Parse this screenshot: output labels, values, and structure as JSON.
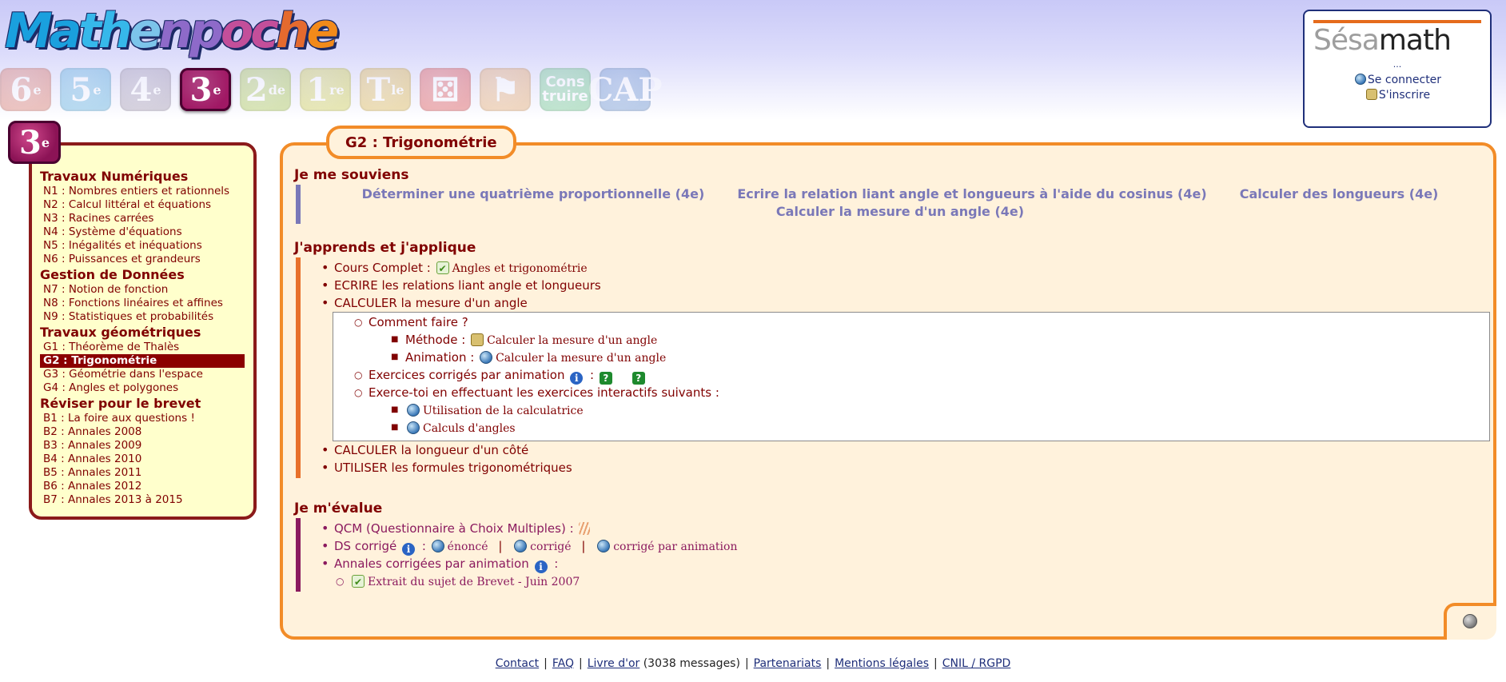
{
  "logo": {
    "text": "Mathenpoche"
  },
  "levels": [
    {
      "label": "6",
      "sup": "e",
      "color": "#d46a5a",
      "active": false
    },
    {
      "label": "5",
      "sup": "e",
      "color": "#4aa6d8",
      "active": false
    },
    {
      "label": "4",
      "sup": "e",
      "color": "#9a8fa8",
      "active": false
    },
    {
      "label": "3",
      "sup": "e",
      "color": "#a01864",
      "active": true
    },
    {
      "label": "2",
      "sup": "de",
      "color": "#a0c040",
      "active": false
    },
    {
      "label": "1",
      "sup": "re",
      "color": "#c8c840",
      "active": false
    },
    {
      "label": "T",
      "sup": "le",
      "color": "#d8b040",
      "active": false
    },
    {
      "label": "⚄",
      "sup": "",
      "color": "#d84040",
      "active": false
    },
    {
      "label": "⚑",
      "sup": "",
      "color": "#e0a060",
      "active": false
    },
    {
      "label": "Cons truire",
      "sup": "",
      "color": "#60c080",
      "active": false
    },
    {
      "label": "CAP",
      "sup": "",
      "color": "#5a88c8",
      "active": false
    }
  ],
  "sesamath": {
    "logo_parts": [
      "Sésa",
      "math"
    ],
    "dots": "...",
    "login": "Se connecter",
    "signup": "S'inscrire"
  },
  "sidebar": {
    "badge_label": "3",
    "badge_sup": "e",
    "sections": [
      {
        "title": "Travaux Numériques",
        "items": [
          {
            "label": "N1 : Nombres entiers et rationnels",
            "active": false
          },
          {
            "label": "N2 : Calcul littéral et équations",
            "active": false
          },
          {
            "label": "N3 : Racines carrées",
            "active": false
          },
          {
            "label": "N4 : Système d'équations",
            "active": false
          },
          {
            "label": "N5 : Inégalités et inéquations",
            "active": false
          },
          {
            "label": "N6 : Puissances et grandeurs",
            "active": false
          }
        ]
      },
      {
        "title": "Gestion de Données",
        "items": [
          {
            "label": "N7 : Notion de fonction",
            "active": false
          },
          {
            "label": "N8 : Fonctions linéaires et affines",
            "active": false
          },
          {
            "label": "N9 : Statistiques et probabilités",
            "active": false
          }
        ]
      },
      {
        "title": "Travaux géométriques",
        "items": [
          {
            "label": "G1 : Théorème de Thalès",
            "active": false
          },
          {
            "label": "G2 : Trigonométrie",
            "active": true
          },
          {
            "label": "G3 : Géométrie dans l'espace",
            "active": false
          },
          {
            "label": "G4 : Angles et polygones",
            "active": false
          }
        ]
      },
      {
        "title": "Réviser pour le brevet",
        "items": [
          {
            "label": "B1 : La foire aux questions !",
            "active": false
          },
          {
            "label": "B2 : Annales 2008",
            "active": false
          },
          {
            "label": "B3 : Annales 2009",
            "active": false
          },
          {
            "label": "B4 : Annales 2010",
            "active": false
          },
          {
            "label": "B5 : Annales 2011",
            "active": false
          },
          {
            "label": "B6 : Annales 2012",
            "active": false
          },
          {
            "label": "B7 : Annales 2013 à 2015",
            "active": false
          }
        ]
      }
    ]
  },
  "main": {
    "tab_title": "G2 : Trigonométrie",
    "recall": {
      "title": "Je me souviens",
      "links": [
        "Déterminer une quatrième proportionnelle (4e)",
        "Ecrire la relation liant angle et longueurs à l'aide du cosinus (4e)",
        "Calculer des longueurs (4e)",
        "Calculer la mesure d'un angle (4e)"
      ]
    },
    "learn": {
      "title": "J'apprends et j'applique",
      "course_label": "Cours Complet :",
      "course_link": "Angles et trigonométrie",
      "write_relations": "ECRIRE les relations liant angle et longueurs",
      "calc_angle": "CALCULER la mesure d'un angle",
      "how_to": "Comment faire ?",
      "method_label": "Méthode :",
      "method_link": "Calculer la mesure d'un angle",
      "animation_label": "Animation :",
      "animation_link": "Calculer la mesure d'un angle",
      "corrected_label": "Exercices corrigés par animation",
      "colon": ":",
      "interactive_label": "Exerce-toi en effectuant les exercices interactifs suivants :",
      "interactive_1": "Utilisation de la calculatrice",
      "interactive_2": "Calculs d'angles",
      "calc_side": "CALCULER la longueur d'un côté",
      "use_formulas": "UTILISER les formules trigonométriques"
    },
    "evaluate": {
      "title": "Je m'évalue",
      "qcm_label": "QCM (Questionnaire à Choix Multiples) :",
      "ds_label": "DS corrigé",
      "colon": ":",
      "ds_enonce": "énoncé",
      "ds_corrige": "corrigé",
      "ds_anim": "corrigé par animation",
      "annales_label": "Annales corrigées par animation",
      "annales_colon": ":",
      "annales_item": "Extrait du sujet de Brevet - Juin 2007"
    }
  },
  "footer": {
    "contact": "Contact",
    "faq": "FAQ",
    "livre": "Livre d'or",
    "messages": "(3038 messages)",
    "partenariats": "Partenariats",
    "mentions": "Mentions légales",
    "cnil": "CNIL / RGPD"
  },
  "colors": {
    "panel_border": "#f28c28",
    "panel_bg": "#fff2dc",
    "sidebar_border": "#8b1a1a",
    "sidebar_bg": "#ffffcc",
    "text": "#800000",
    "recall_link": "#7a78b8"
  }
}
